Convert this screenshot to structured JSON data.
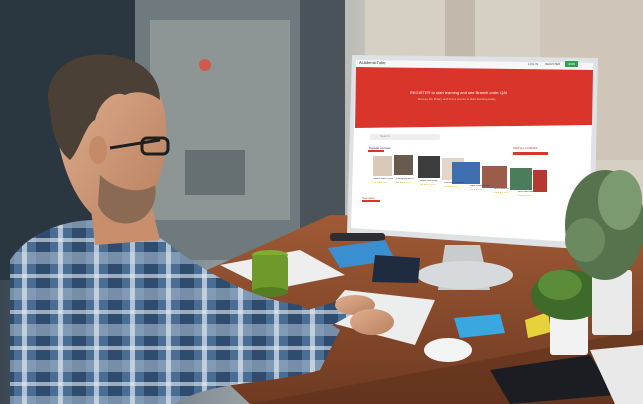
{
  "screen": {
    "logo": "AcademicTube",
    "nav_login": "LOG IN",
    "nav_register": "REGISTER",
    "nav_join": "JOIN",
    "hero_title": "REGISTER to start learning and see Branch code: QA!",
    "hero_subtitle": "Browse the library and find a course to start learning today",
    "search_placeholder": "Search",
    "section_label": "Popular courses",
    "view_all": "VIEW ALL COURSES",
    "see_more": "See more",
    "promo": "FEATURED",
    "courses": [
      {
        "title": "Learn to code in Python",
        "price": "$9.99",
        "rating": "★★★★★"
      },
      {
        "title": "Photography basics",
        "price": "$9.99",
        "rating": "★★★★★"
      },
      {
        "title": "Modern web design",
        "price": "$12.99",
        "rating": "★★★★★"
      },
      {
        "title": "Data science essentials",
        "price": "$9.99",
        "rating": "★★★★★"
      },
      {
        "title": "Digital marketing course",
        "price": "$9.99",
        "rating": "★★★★★"
      },
      {
        "title": "Intro to business",
        "price": "$9.99",
        "rating": "★★★★★"
      },
      {
        "title": "Music production",
        "price": "$9.99",
        "rating": "★★★★★"
      }
    ]
  },
  "colors": {
    "accent_red": "#d9352b",
    "join_green": "#2ea44f",
    "desk_wood": "#8a4a2c",
    "shirt_blue": "#3d5f86",
    "mug_green": "#6d9a2b",
    "note_blue": "#3ba7e0",
    "note_yellow": "#e6d23a"
  }
}
